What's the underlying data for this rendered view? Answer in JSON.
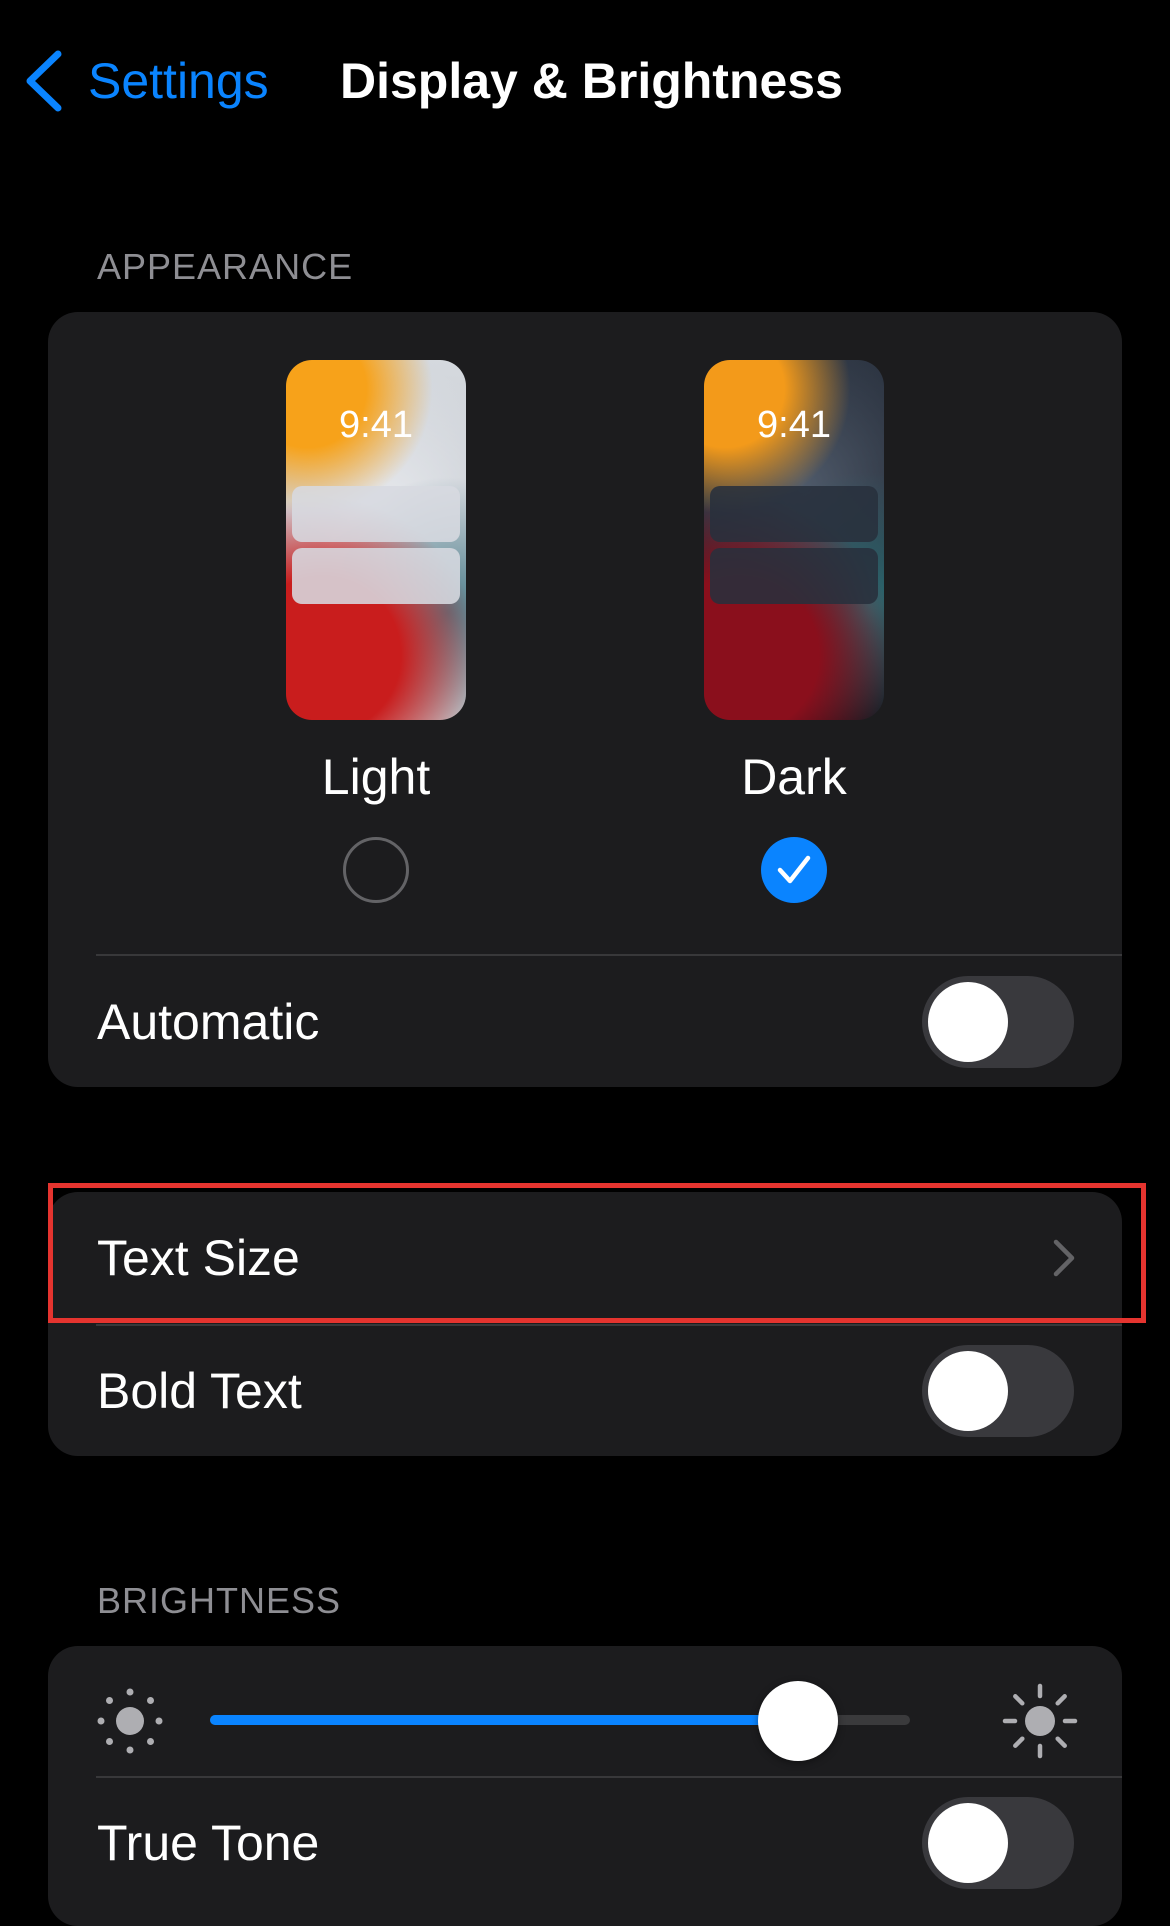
{
  "nav": {
    "back_label": "Settings",
    "title": "Display & Brightness"
  },
  "appearance": {
    "header": "APPEARANCE",
    "light": {
      "time": "9:41",
      "label": "Light",
      "selected": false
    },
    "dark": {
      "time": "9:41",
      "label": "Dark",
      "selected": true
    },
    "automatic": {
      "label": "Automatic",
      "on": false
    }
  },
  "text": {
    "text_size_label": "Text Size",
    "bold_text": {
      "label": "Bold Text",
      "on": false
    }
  },
  "brightness": {
    "header": "BRIGHTNESS",
    "level": 0.84,
    "true_tone": {
      "label": "True Tone",
      "on": false
    }
  },
  "colors": {
    "accent": "#0a84ff",
    "highlight": "#e5342f",
    "group_bg": "#1c1c1e"
  }
}
